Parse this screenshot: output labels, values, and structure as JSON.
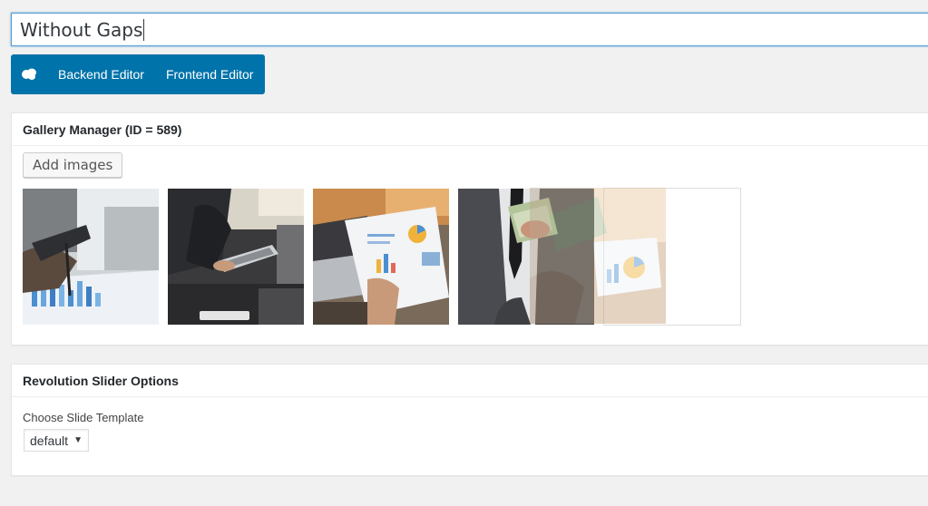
{
  "post_title": {
    "value": "Without Gaps"
  },
  "editor_bar": {
    "backend_label": "Backend Editor",
    "frontend_label": "Frontend Editor",
    "color": "#0073aa"
  },
  "gallery_manager": {
    "title": "Gallery Manager (ID = 589)",
    "add_button": "Add images",
    "images": [
      {
        "name": "pen-chart-photo"
      },
      {
        "name": "tablet-meeting-photo"
      },
      {
        "name": "laptop-report-photo"
      },
      {
        "name": "money-tablet-photo"
      }
    ]
  },
  "slider_options": {
    "title": "Revolution Slider Options",
    "template_label": "Choose Slide Template",
    "template_selected": "default"
  }
}
